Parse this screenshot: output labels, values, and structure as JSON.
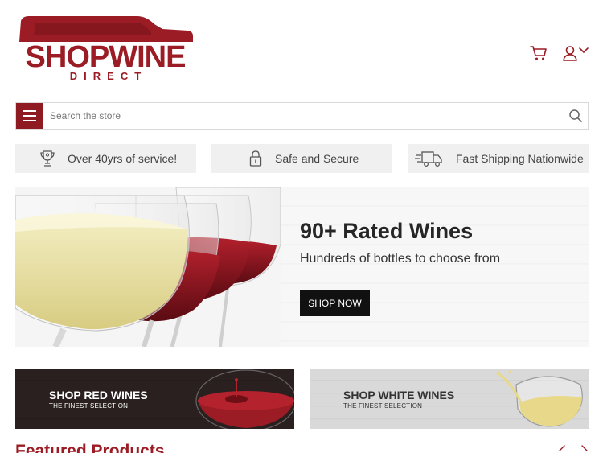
{
  "header": {
    "logo_main": "SHOPWINE",
    "logo_sub": "DIRECT",
    "icons": [
      "cart-icon",
      "user-icon",
      "chevron-down-icon"
    ]
  },
  "search": {
    "placeholder": "Search the store",
    "value": ""
  },
  "features": [
    {
      "icon": "trophy-icon",
      "label": "Over 40yrs of service!"
    },
    {
      "icon": "lock-icon",
      "label": "Safe and Secure"
    },
    {
      "icon": "truck-icon",
      "label": "Fast Shipping Nationwide"
    }
  ],
  "hero": {
    "title": "90+ Rated Wines",
    "subtitle": "Hundreds of bottles to choose from",
    "button": "SHOP NOW"
  },
  "banners": [
    {
      "title": "SHOP RED WINES",
      "subtitle": "THE FINEST SELECTION"
    },
    {
      "title": "SHOP WHITE WINES",
      "subtitle": "THE FINEST SELECTION"
    }
  ],
  "featured": {
    "title": "Featured Products"
  },
  "colors": {
    "brand": "#9b1c24",
    "menu": "#8e1a22",
    "tile_bg": "#f0f0f0",
    "button_bg": "#111111"
  }
}
